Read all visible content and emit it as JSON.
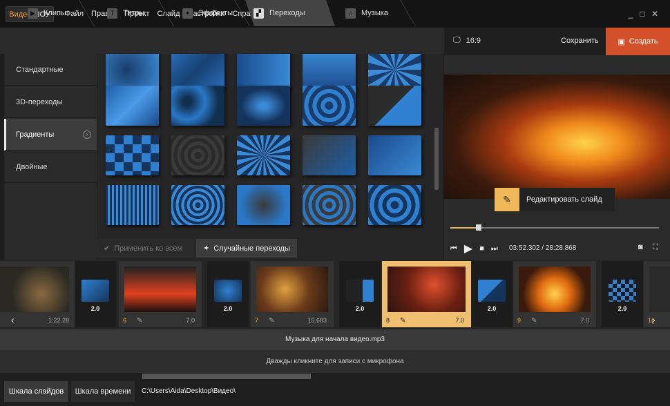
{
  "app": {
    "logo_a": "Видео",
    "logo_b": "ШОУ"
  },
  "menu": [
    "Файл",
    "Правка",
    "Проект",
    "Слайд",
    "Настройки",
    "Справка"
  ],
  "window": {
    "min": "_",
    "max": "□",
    "close": "✕"
  },
  "tabs": [
    {
      "label": "Клипы",
      "icon": "film-icon"
    },
    {
      "label": "Титры",
      "icon": "text-icon"
    },
    {
      "label": "Эффекты",
      "icon": "wand-icon"
    },
    {
      "label": "Переходы",
      "icon": "transition-icon",
      "active": true
    },
    {
      "label": "Музыка",
      "icon": "music-icon"
    }
  ],
  "sidebar": [
    {
      "label": "Стандартные"
    },
    {
      "label": "3D-переходы"
    },
    {
      "label": "Градиенты",
      "active": true
    },
    {
      "label": "Двойные"
    }
  ],
  "grid_buttons": {
    "apply_all": "Применить ко всем",
    "random": "Случайные переходы"
  },
  "preview": {
    "ratio": "16:9",
    "save": "Сохранить",
    "create": "Создать",
    "edit_slide": "Редактировать слайд",
    "time": "03:52.302 / 28:28.868",
    "progress": 0.137
  },
  "timeline": {
    "slides": [
      {
        "num": "",
        "dur": "1:22.28"
      },
      {
        "num": "6",
        "dur": "7.0"
      },
      {
        "num": "7",
        "dur": "15.683"
      },
      {
        "num": "8",
        "dur": "7.0",
        "selected": true
      },
      {
        "num": "9",
        "dur": "7.0"
      }
    ],
    "transitions": [
      "2.0",
      "2.0",
      "2.0",
      "2.0",
      "2.0"
    ],
    "edge_number": "1("
  },
  "music_track": "Музыка для начала видео.mp3",
  "voice_track": "Дважды кликните для записи с микрофона",
  "bottom": {
    "tab_slides": "Шкала слайдов",
    "tab_time": "Шкала времени",
    "path": "C:\\Users\\Aida\\Desktop\\Видео\\"
  },
  "colors": {
    "accent": "#d4502a",
    "highlight": "#f0c070"
  }
}
